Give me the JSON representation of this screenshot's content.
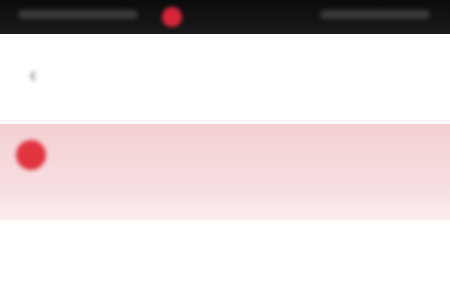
{
  "status_bar": {
    "left_text": "",
    "right_text": ""
  },
  "header": {
    "back_icon": "chevron-left-icon",
    "title": "",
    "subtitle": ""
  },
  "alert": {
    "icon": "alert-icon",
    "message": "",
    "link_label": ""
  },
  "colors": {
    "topbar": "#111111",
    "recording_dot": "#d8253a",
    "alert_bg": "#f4d3d6",
    "alert_icon": "#e1343f"
  }
}
